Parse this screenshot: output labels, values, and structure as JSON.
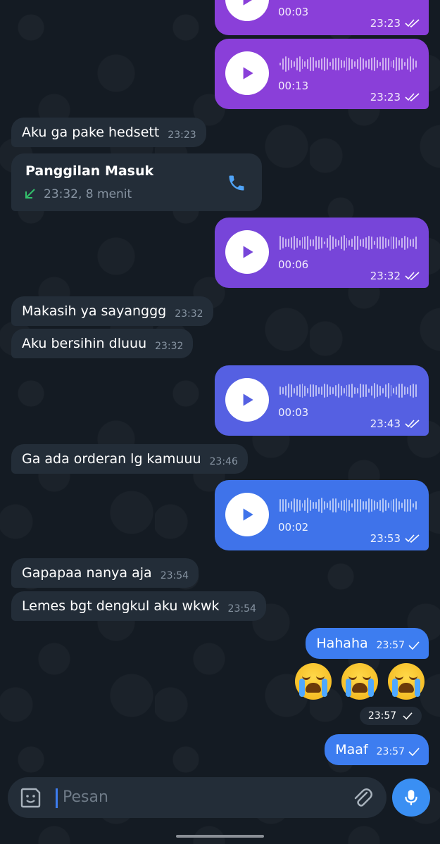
{
  "voice_messages": [
    {
      "duration": "00:03",
      "time": "23:23",
      "color": "#8a3fd9"
    },
    {
      "duration": "00:13",
      "time": "23:23",
      "color": "#8a3fd9"
    },
    {
      "duration": "00:06",
      "time": "23:32",
      "color": "#7745d9"
    },
    {
      "duration": "00:03",
      "time": "23:43",
      "color": "#5560e2"
    },
    {
      "duration": "00:02",
      "time": "23:53",
      "color": "#3f73ea"
    }
  ],
  "incoming": [
    {
      "text": "Aku ga pake hedsett",
      "time": "23:23"
    },
    {
      "text": "Makasih ya sayanggg",
      "time": "23:32"
    },
    {
      "text": "Aku bersihin dluuu",
      "time": "23:32"
    },
    {
      "text": "Ga ada orderan lg kamuuu",
      "time": "23:46"
    },
    {
      "text": "Gapapaa nanya aja",
      "time": "23:54"
    },
    {
      "text": "Lemes bgt dengkul aku wkwk",
      "time": "23:54"
    }
  ],
  "call": {
    "title": "Panggilan Masuk",
    "detail": "23:32, 8 menit"
  },
  "outgoing": [
    {
      "text": "Hahaha",
      "time": "23:57"
    },
    {
      "text": "Maaf",
      "time": "23:57"
    }
  ],
  "emoji_message": {
    "emoji": "😭😭😭",
    "time": "23:57"
  },
  "input": {
    "placeholder": "Pesan"
  },
  "colors": {
    "background": "#141b23",
    "incoming_bubble": "#232d38",
    "outgoing_bubble": "#3d7df0",
    "mic_button": "#3a8ff3"
  }
}
